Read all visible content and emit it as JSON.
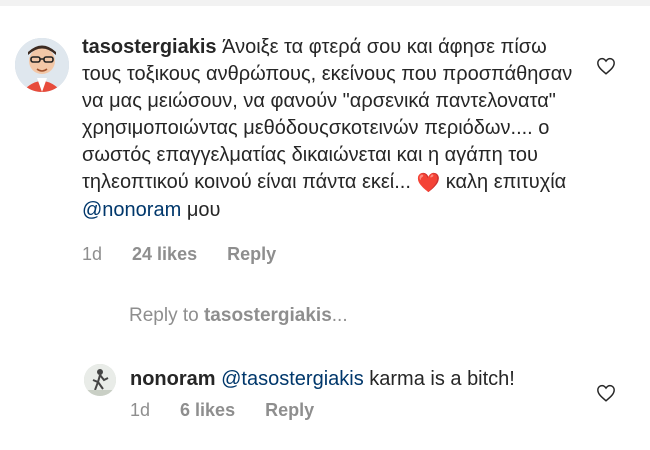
{
  "comments": [
    {
      "username": "tasostergiakis",
      "text_before_mention": "Άνοιξε τα φτερά σου και άφησε πίσω τους τοξικους ανθρώπους, εκείνους που προσπάθησαν να μας μειώσουν, να φανούν \"αρσενικά παντελονατα\" χρησιμοποιώντας μεθόδουςσκοτεινών περιόδων.... ο σωστός επαγγελματίας δικαιώνεται και η αγάπη του τηλεοπτικού κοινού είναι πάντα εκεί...",
      "heart": "❤️",
      "text_after_heart": " καλη επιτυχία ",
      "mention": "@nonoram",
      "text_after_mention": " μου",
      "age": "1d",
      "likes": "24 likes",
      "reply_label": "Reply"
    },
    {
      "username": "nonoram",
      "mention": "@tasostergiakis",
      "text_after_mention": " karma is a bitch!",
      "age": "1d",
      "likes": "6 likes",
      "reply_label": "Reply"
    }
  ],
  "reply_to": {
    "prefix": "Reply to ",
    "name": "tasostergiakis",
    "suffix": "..."
  },
  "icons": {
    "like": "heart-outline-icon",
    "avatar_main": "avatar",
    "avatar_reply": "avatar"
  },
  "colors": {
    "text": "#262626",
    "muted": "#8e8e8e",
    "mention": "#00376b",
    "heart": "#e0245e"
  }
}
